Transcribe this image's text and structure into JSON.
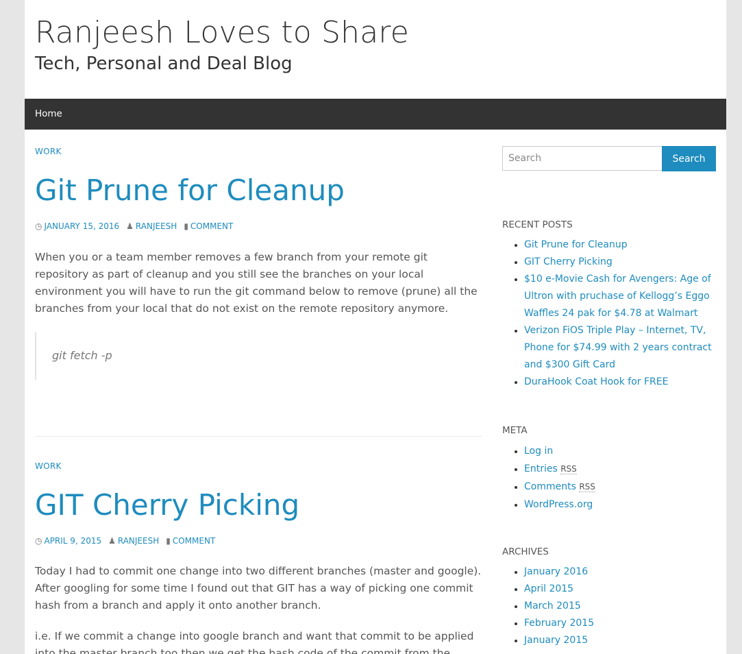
{
  "site": {
    "title": "Ranjeesh Loves to Share",
    "tagline": "Tech, Personal and Deal Blog"
  },
  "nav": {
    "home": "Home"
  },
  "posts": [
    {
      "category": "WORK",
      "title": "Git Prune for Cleanup",
      "date": "JANUARY 15, 2016",
      "author": "RANJEESH",
      "comment": "COMMENT",
      "paragraph": "When you or a team member removes a few branch from your remote git repository as part of cleanup and you still see the branches on your local environment you will have to run the git command below to remove (prune) all the branches from your local that do not exist on the remote repository anymore.",
      "quote": "git fetch -p"
    },
    {
      "category": "WORK",
      "title": "GIT Cherry Picking",
      "date": "APRIL 9, 2015",
      "author": "RANJEESH",
      "comment": "COMMENT",
      "paragraph": "Today I had to commit one change into two different branches (master and google). After googling for some time I found out that GIT has a way of picking one commit hash from a branch and apply it onto another branch.",
      "paragraph2": "i.e. If we commit a change into google branch and want that commit to be applied into the master branch too then we get the hash code of the commit from the google branch using"
    }
  ],
  "search": {
    "placeholder": "Search",
    "button": "Search"
  },
  "recent_posts": {
    "title": "RECENT POSTS",
    "items": [
      "Git Prune for Cleanup",
      "GIT Cherry Picking",
      "$10 e-Movie Cash for Avengers: Age of Ultron with pruchase of Kellogg’s Eggo Waffles 24 pak for $4.78 at Walmart",
      "Verizon FiOS Triple Play – Internet, TV, Phone for $74.99 with 2 years contract and $300 Gift Card",
      "DuraHook Coat Hook for FREE"
    ]
  },
  "meta_widget": {
    "title": "META",
    "login": "Log in",
    "entries": "Entries",
    "comments": "Comments",
    "rss": "RSS",
    "wordpress": "WordPress.org"
  },
  "archives": {
    "title": "ARCHIVES",
    "items": [
      "January 2016",
      "April 2015",
      "March 2015",
      "February 2015",
      "January 2015"
    ]
  },
  "colors": {
    "accent": "#1e8cbe",
    "navbar": "#333333",
    "background": "#e6e6e6"
  },
  "icons": {
    "date": "clock-icon",
    "author": "user-icon",
    "comment": "comment-icon"
  }
}
